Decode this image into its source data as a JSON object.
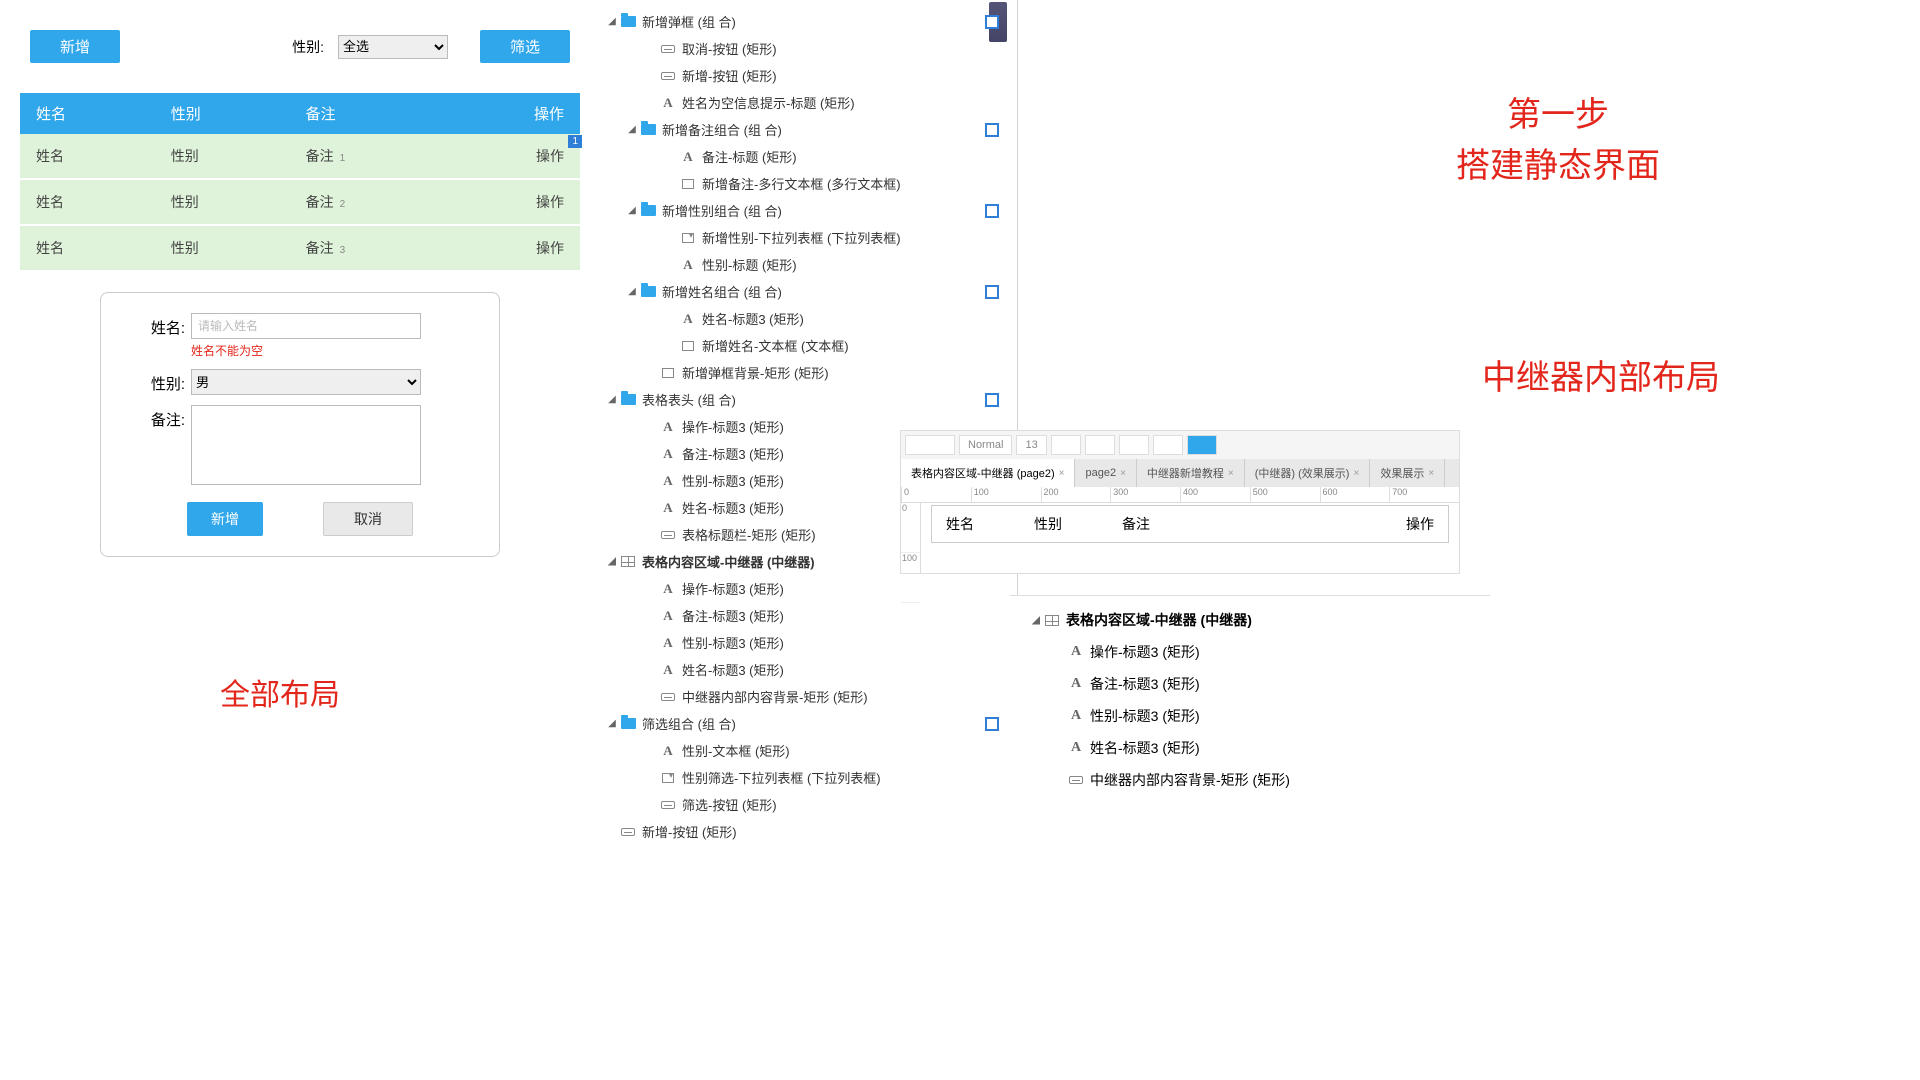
{
  "toolbar": {
    "add_btn": "新增",
    "gender_label": "性别:",
    "gender_value": "全选",
    "filter_btn": "筛选"
  },
  "table": {
    "headers": {
      "name": "姓名",
      "gender": "性别",
      "remark": "备注",
      "ops": "操作"
    },
    "rows": [
      {
        "name": "姓名",
        "gender": "性别",
        "remark": "备注",
        "idx": "1",
        "ops": "操作"
      },
      {
        "name": "姓名",
        "gender": "性别",
        "remark": "备注",
        "idx": "2",
        "ops": "操作"
      },
      {
        "name": "姓名",
        "gender": "性别",
        "remark": "备注",
        "idx": "3",
        "ops": "操作"
      }
    ],
    "page_badge": "1"
  },
  "form": {
    "name_label": "姓名:",
    "name_placeholder": "请输入姓名",
    "name_error": "姓名不能为空",
    "gender_label": "性别:",
    "gender_value": "男",
    "remark_label": "备注:",
    "add_btn": "新增",
    "cancel_btn": "取消"
  },
  "captions": {
    "full_layout": "全部布局",
    "step1_line1": "第一步",
    "step1_line2": "搭建静态界面",
    "repeater": "中继器内部布局"
  },
  "tree": {
    "n1": "新增弹框 (组 合)",
    "n1a": "取消-按钮 (矩形)",
    "n1b": "新增-按钮 (矩形)",
    "n1c": "姓名为空信息提示-标题 (矩形)",
    "n2": "新增备注组合 (组 合)",
    "n2a": "备注-标题 (矩形)",
    "n2b": "新增备注-多行文本框 (多行文本框)",
    "n3": "新增性别组合 (组 合)",
    "n3a": "新增性别-下拉列表框 (下拉列表框)",
    "n3b": "性别-标题 (矩形)",
    "n4": "新增姓名组合 (组 合)",
    "n4a": "姓名-标题3 (矩形)",
    "n4b": "新增姓名-文本框 (文本框)",
    "n4c": "新增弹框背景-矩形 (矩形)",
    "n5": "表格表头 (组 合)",
    "n5a": "操作-标题3 (矩形)",
    "n5b": "备注-标题3 (矩形)",
    "n5c": "性别-标题3 (矩形)",
    "n5d": "姓名-标题3 (矩形)",
    "n5e": "表格标题栏-矩形 (矩形)",
    "n6": "表格内容区域-中继器 (中继器)",
    "n6a": "操作-标题3 (矩形)",
    "n6b": "备注-标题3 (矩形)",
    "n6c": "性别-标题3 (矩形)",
    "n6d": "姓名-标题3 (矩形)",
    "n6e": "中继器内部内容背景-矩形 (矩形)",
    "n7": "筛选组合 (组 合)",
    "n7a": "性别-文本框 (矩形)",
    "n7b": "性别筛选-下拉列表框 (下拉列表框)",
    "n7c": "筛选-按钮 (矩形)",
    "n8": "新增-按钮 (矩形)"
  },
  "editor": {
    "font_style": "Normal",
    "font_size": "13",
    "tabs": [
      {
        "label": "表格内容区域-中继器 (page2)",
        "active": true
      },
      {
        "label": "page2"
      },
      {
        "label": "中继器新增教程"
      },
      {
        "label": "(中继器) (效果展示)"
      },
      {
        "label": "效果展示"
      }
    ],
    "ruler_h": [
      "0",
      "100",
      "200",
      "300",
      "400",
      "500",
      "600",
      "700"
    ],
    "ruler_v": [
      "0",
      "100"
    ],
    "row": {
      "name": "姓名",
      "gender": "性别",
      "remark": "备注",
      "ops": "操作"
    }
  },
  "tree2": {
    "root": "表格内容区域-中继器 (中继器)",
    "a": "操作-标题3 (矩形)",
    "b": "备注-标题3 (矩形)",
    "c": "性别-标题3 (矩形)",
    "d": "姓名-标题3 (矩形)",
    "e": "中继器内部内容背景-矩形 (矩形)"
  }
}
